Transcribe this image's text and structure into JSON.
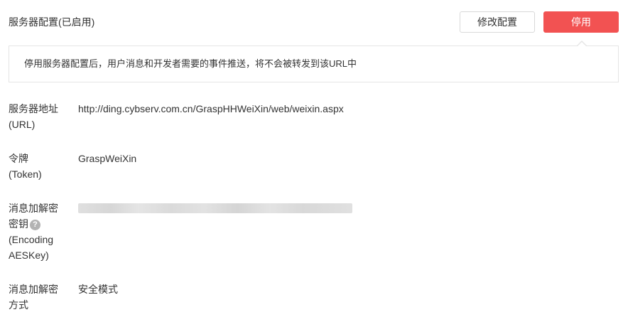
{
  "header": {
    "title": "服务器配置(已启用)",
    "modify_label": "修改配置",
    "disable_label": "停用"
  },
  "tip": {
    "text": "停用服务器配置后，用户消息和开发者需要的事件推送，将不会被转发到该URL中"
  },
  "fields": {
    "url": {
      "label_line1": "服务器地址",
      "label_line2": "(URL)",
      "value": "http://ding.cybserv.com.cn/GraspHHWeiXin/web/weixin.aspx"
    },
    "token": {
      "label_line1": "令牌",
      "label_line2": "(Token)",
      "value": "GraspWeiXin"
    },
    "aeskey": {
      "label_line1": "消息加解密",
      "label_line2": "密钥",
      "label_line3": "(Encoding",
      "label_line4": "AESKey)",
      "help_icon": "?"
    },
    "encrypt_mode": {
      "label_line1": "消息加解密",
      "label_line2": "方式",
      "value": "安全模式"
    }
  },
  "colors": {
    "accent_red": "#f25252",
    "border": "#e5e5e5",
    "text": "#333333"
  }
}
